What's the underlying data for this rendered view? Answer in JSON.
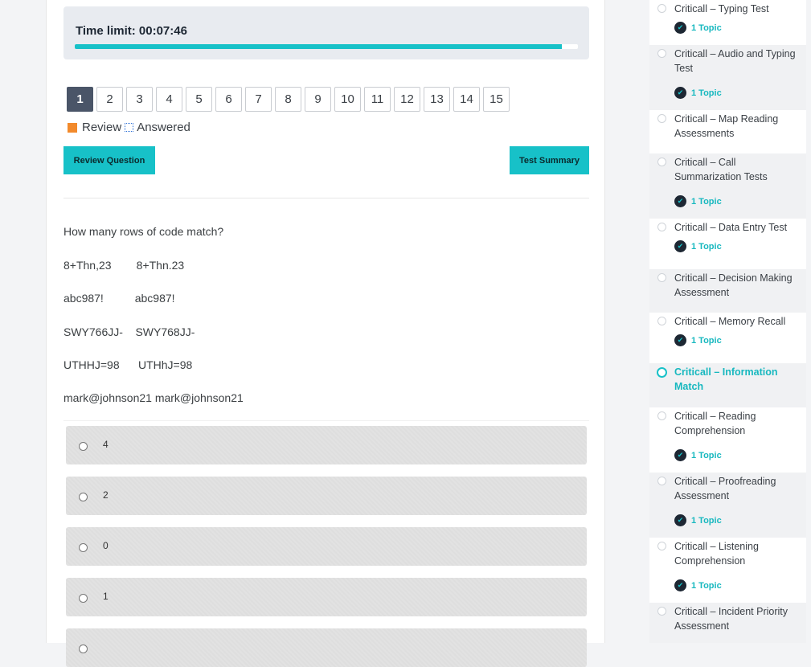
{
  "timer": {
    "label": "Time limit: 00:07:46",
    "progress_fraction": 0.968
  },
  "pager": {
    "pages": [
      "1",
      "2",
      "3",
      "4",
      "5",
      "6",
      "7",
      "8",
      "9",
      "10",
      "11",
      "12",
      "13",
      "14",
      "15"
    ],
    "active": "1"
  },
  "legend": {
    "review": "Review",
    "answered": "Answered",
    "review_color": "#f28a2c",
    "answered_color": "#2b6fd6"
  },
  "buttons": {
    "review_question": "Review Question",
    "test_summary": "Test Summary",
    "accent": "#17c1c8"
  },
  "question": {
    "prompt": "How many rows of code match?",
    "rows": [
      "8+Thn,23        8+Thn.23",
      "abc987!          abc987!",
      "SWY766JJ-    SWY768JJ-",
      "UTHHJ=98      UTHhJ=98",
      "mark@johnson21 mark@johnson21"
    ],
    "options": [
      "4",
      "2",
      "0",
      "1",
      ""
    ]
  },
  "sidebar": {
    "lessons": [
      {
        "title": "Criticall – Typing Test",
        "topic": "1 Topic",
        "active": false
      },
      {
        "title": "Criticall – Audio and Typing Test",
        "topic": "1 Topic",
        "active": false
      },
      {
        "title": "Criticall – Map Reading Assessments",
        "topic": "",
        "active": false
      },
      {
        "title": "Criticall – Call Summarization Tests",
        "topic": "1 Topic",
        "active": false
      },
      {
        "title": "Criticall – Data Entry Test",
        "topic": "1 Topic",
        "active": false
      },
      {
        "title": "Criticall – Decision Making Assessment",
        "topic": "",
        "active": false
      },
      {
        "title": "Criticall – Memory Recall",
        "topic": "1 Topic",
        "active": false
      },
      {
        "title": "Criticall – Information Match",
        "topic": "",
        "active": true
      },
      {
        "title": "Criticall – Reading Comprehension",
        "topic": "1 Topic",
        "active": false
      },
      {
        "title": "Criticall – Proofreading Assessment",
        "topic": "1 Topic",
        "active": false
      },
      {
        "title": "Criticall – Listening Comprehension",
        "topic": "1 Topic",
        "active": false
      },
      {
        "title": "Criticall – Incident Priority Assessment",
        "topic": "",
        "active": false
      }
    ]
  }
}
